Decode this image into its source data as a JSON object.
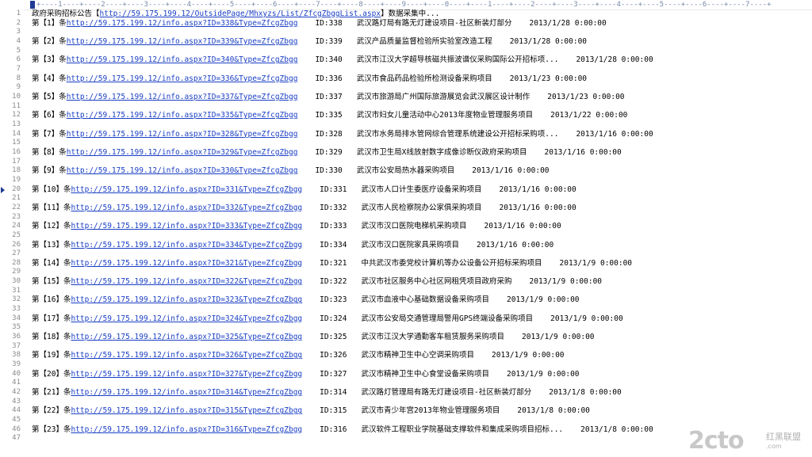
{
  "ruler": {
    "text": "+----1----+----2----+----3----+----4----+----5----+----6----+----7----+----8----+----9----+----0----+----1----+----2----+----3----+----4----+----5----+----6----+----7----+"
  },
  "header_line": {
    "number": "1",
    "prefix": "政府采购招标公告【",
    "url": "http://59.175.199.12/OutsidePage/Mhxyzs/List/ZfcgZbggList.aspx",
    "suffix": "】数据采集中..."
  },
  "entries": [
    {
      "number": "2",
      "label": "第【1】条",
      "url": "http://59.175.199.12/info.aspx?ID=338&Type=ZfcgZbgg",
      "id": "ID:338",
      "title": "武汉路灯局有路无灯建设项目-社区新装灯部分",
      "date": "2013/1/28 0:00:00"
    },
    {
      "number": "4",
      "label": "第【2】条",
      "url": "http://59.175.199.12/info.aspx?ID=339&Type=ZfcgZbgg",
      "id": "ID:339",
      "title": "武汉产品质量监督检验所实验室改造工程",
      "date": "2013/1/28 0:00:00"
    },
    {
      "number": "6",
      "label": "第【3】条",
      "url": "http://59.175.199.12/info.aspx?ID=340&Type=ZfcgZbgg",
      "id": "ID:340",
      "title": "武汉市江汉大学超导核磁共振波谱仪采购国际公开招标项...",
      "date": "2013/1/28 0:00:00"
    },
    {
      "number": "8",
      "label": "第【4】条",
      "url": "http://59.175.199.12/info.aspx?ID=336&Type=ZfcgZbgg",
      "id": "ID:336",
      "title": "武汉市食品药品检验所检测设备采购项目",
      "date": "2013/1/23 0:00:00"
    },
    {
      "number": "10",
      "label": "第【5】条",
      "url": "http://59.175.199.12/info.aspx?ID=337&Type=ZfcgZbgg",
      "id": "ID:337",
      "title": "武汉市旅游局广州国际旅游展览会武汉展区设计制作",
      "date": "2013/1/23 0:00:00"
    },
    {
      "number": "12",
      "label": "第【6】条",
      "url": "http://59.175.199.12/info.aspx?ID=335&Type=ZfcgZbgg",
      "id": "ID:335",
      "title": "武汉市妇女儿童活动中心2013年度物业管理服务项目",
      "date": "2013/1/22 0:00:00"
    },
    {
      "number": "14",
      "label": "第【7】条",
      "url": "http://59.175.199.12/info.aspx?ID=328&Type=ZfcgZbgg",
      "id": "ID:328",
      "title": "武汉市水务局排水管网综合管理系统建设公开招标采购项...",
      "date": "2013/1/16 0:00:00"
    },
    {
      "number": "16",
      "label": "第【8】条",
      "url": "http://59.175.199.12/info.aspx?ID=329&Type=ZfcgZbgg",
      "id": "ID:329",
      "title": "武汉市卫生局X线放射数字成像诊断仪政府采购项目",
      "date": "2013/1/16 0:00:00"
    },
    {
      "number": "18",
      "label": "第【9】条",
      "url": "http://59.175.199.12/info.aspx?ID=330&Type=ZfcgZbgg",
      "id": "ID:330",
      "title": "武汉市公安局热水器采购项目",
      "date": "2013/1/16 0:00:00"
    },
    {
      "number": "20",
      "label": "第【10】条",
      "url": "http://59.175.199.12/info.aspx?ID=331&Type=ZfcgZbgg",
      "id": "ID:331",
      "title": "武汉市人口计生委医疗设备采购项目",
      "date": "2013/1/16 0:00:00"
    },
    {
      "number": "22",
      "label": "第【11】条",
      "url": "http://59.175.199.12/info.aspx?ID=332&Type=ZfcgZbgg",
      "id": "ID:332",
      "title": "武汉市人民检察院办公家俱采购项目",
      "date": "2013/1/16 0:00:00"
    },
    {
      "number": "24",
      "label": "第【12】条",
      "url": "http://59.175.199.12/info.aspx?ID=333&Type=ZfcgZbgg",
      "id": "ID:333",
      "title": "武汉市汉口医院电梯机采购项目",
      "date": "2013/1/16 0:00:00"
    },
    {
      "number": "26",
      "label": "第【13】条",
      "url": "http://59.175.199.12/info.aspx?ID=334&Type=ZfcgZbgg",
      "id": "ID:334",
      "title": "武汉市汉口医院家具采购项目",
      "date": "2013/1/16 0:00:00"
    },
    {
      "number": "28",
      "label": "第【14】条",
      "url": "http://59.175.199.12/info.aspx?ID=321&Type=ZfcgZbgg",
      "id": "ID:321",
      "title": "中共武汉市委党校计算机等办公设备公开招标采购项目",
      "date": "2013/1/9 0:00:00"
    },
    {
      "number": "30",
      "label": "第【15】条",
      "url": "http://59.175.199.12/info.aspx?ID=322&Type=ZfcgZbgg",
      "id": "ID:322",
      "title": "武汉市社区服务中心社区网租凭项目政府采购",
      "date": "2013/1/9 0:00:00"
    },
    {
      "number": "32",
      "label": "第【16】条",
      "url": "http://59.175.199.12/info.aspx?ID=323&Type=ZfcgZbgg",
      "id": "ID:323",
      "title": "武汉市血液中心基础数据设备采购项目",
      "date": "2013/1/9 0:00:00"
    },
    {
      "number": "34",
      "label": "第【17】条",
      "url": "http://59.175.199.12/info.aspx?ID=324&Type=ZfcgZbgg",
      "id": "ID:324",
      "title": "武汉市公安局交通管理局警用GPS终端设备采购项目",
      "date": "2013/1/9 0:00:00"
    },
    {
      "number": "36",
      "label": "第【18】条",
      "url": "http://59.175.199.12/info.aspx?ID=325&Type=ZfcgZbgg",
      "id": "ID:325",
      "title": "武汉市江汉大学通勤客车租赁服务采购项目",
      "date": "2013/1/9 0:00:00"
    },
    {
      "number": "38",
      "label": "第【19】条",
      "url": "http://59.175.199.12/info.aspx?ID=326&Type=ZfcgZbgg",
      "id": "ID:326",
      "title": "武汉市精神卫生中心空调采购项目",
      "date": "2013/1/9 0:00:00"
    },
    {
      "number": "40",
      "label": "第【20】条",
      "url": "http://59.175.199.12/info.aspx?ID=327&Type=ZfcgZbgg",
      "id": "ID:327",
      "title": "武汉市精神卫生中心食堂设备采购项目",
      "date": "2013/1/9 0:00:00"
    },
    {
      "number": "42",
      "label": "第【21】条",
      "url": "http://59.175.199.12/info.aspx?ID=314&Type=ZfcgZbgg",
      "id": "ID:314",
      "title": "武汉路灯管理局有路无灯建设项目-社区新装灯部分",
      "date": "2013/1/8 0:00:00"
    },
    {
      "number": "44",
      "label": "第【22】条",
      "url": "http://59.175.199.12/info.aspx?ID=315&Type=ZfcgZbgg",
      "id": "ID:315",
      "title": "武汉市青少年宫2013年物业管理服务项目",
      "date": "2013/1/8 0:00:00"
    },
    {
      "number": "46",
      "label": "第【23】条",
      "url": "http://59.175.199.12/info.aspx?ID=316&Type=ZfcgZbgg",
      "id": "ID:316",
      "title": "武汉软件工程职业学院基础支撑软件和集成采购项目招标...",
      "date": "2013/1/8 0:00:00"
    }
  ],
  "odd_line_numbers": [
    "3",
    "5",
    "7",
    "9",
    "11",
    "13",
    "15",
    "17",
    "19",
    "21",
    "23",
    "25",
    "27",
    "29",
    "31",
    "33",
    "35",
    "37",
    "39",
    "41",
    "43",
    "45",
    "47"
  ],
  "current_line": "20",
  "watermark": {
    "main": "2cto",
    "sub": "红黑联盟",
    "url": ".com"
  }
}
